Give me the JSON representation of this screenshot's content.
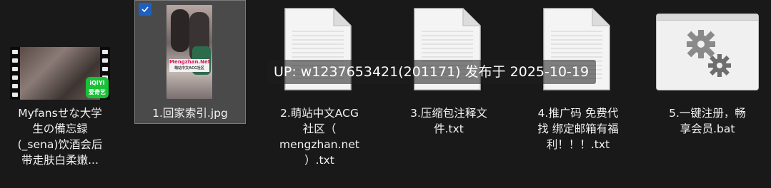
{
  "files": [
    {
      "label": "Myfansせな大学\n生の備忘録\n(_sena)饮酒会后\n带走肤白柔嫩...",
      "type": "video",
      "icon": "video-thumbnail-icon"
    },
    {
      "label": "1.回家索引.jpg",
      "type": "jpg",
      "icon": "image-thumbnail-icon",
      "selected": true
    },
    {
      "label": "2.萌站中文ACG\n社区（\nmengzhan.net\n）.txt",
      "type": "txt",
      "icon": "text-document-icon"
    },
    {
      "label": "3.压缩包注释文\n件.txt",
      "type": "txt",
      "icon": "text-document-icon"
    },
    {
      "label": "4.推广码 免费代\n找 绑定邮箱有福\n利！！！.txt",
      "type": "txt",
      "icon": "text-document-icon"
    },
    {
      "label": "5.一键注册，畅\n享会员.bat",
      "type": "bat",
      "icon": "gear-icon"
    }
  ],
  "thumb": {
    "video_badge_line1": "iQIYI",
    "video_badge_line2": "爱奇艺",
    "jpg_banner_line1": "Mengzhan.Net",
    "jpg_banner_line2": "萌站中文ACG社区"
  },
  "watermark": "UP: w1237653421(201171) 发布于 2025-10-19",
  "colors": {
    "background": "#191919",
    "selection": "#4a4a4a",
    "checkbox": "#1f5fbf",
    "iqiyi": "#19c137"
  }
}
